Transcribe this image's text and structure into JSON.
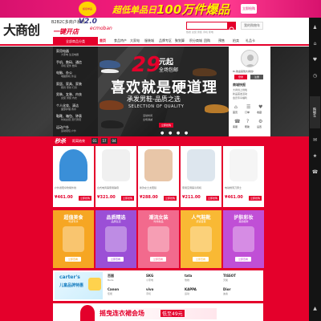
{
  "colors": {
    "brand_red": "#e4002b",
    "banner_pink": "#f21c7a",
    "banner_yellow": "#fff200",
    "hero_dark": "#2b2b2b",
    "sidebar_dark": "#141414"
  },
  "top_banner": {
    "pre": "超低单品日",
    "main": "100万件爆品",
    "badge": "超级单品",
    "button": "立即抢购"
  },
  "logo": {
    "main": "大商创",
    "subtitle": "B2B2C多商户系统",
    "version": "V2.0",
    "slogan": "一键开店",
    "tag": "ecmoban"
  },
  "header": {
    "cart_label": "我的购物车",
    "hot_words": "热搜 女装 男装 手机 家电"
  },
  "nav": {
    "all_categories": "全部商品分类",
    "items": [
      "首页",
      "食品特产",
      "大家电",
      "服装城",
      "品牌专区",
      "聚划算",
      "积分商城",
      "团购",
      "预售",
      "拍卖",
      "礼品卡"
    ]
  },
  "category_menu": [
    {
      "label": "家用电器",
      "sub": "大家电 生活电器"
    },
    {
      "label": "手机、数码、通信",
      "sub": "手机 配件 数码"
    },
    {
      "label": "电脑、办公",
      "sub": "电脑整机 外设"
    },
    {
      "label": "家居、家具、家装",
      "sub": "厨具 家纺 灯具"
    },
    {
      "label": "男装、女装、内衣",
      "sub": "女装 男装 内衣"
    },
    {
      "label": "个人化妆、清洁",
      "sub": "面部护理 香水"
    },
    {
      "label": "鞋靴、箱包、钟表",
      "sub": "时尚女鞋 流行男鞋"
    },
    {
      "label": "运动户外",
      "sub": "运动鞋包 户外"
    }
  ],
  "hero": {
    "number": "29",
    "unit": "元起",
    "shipping": "全场包邮",
    "title": "喜欢就是硬道理",
    "subtitle": "承发男鞋-品质之选",
    "english": "SELECTION OF QUALITY",
    "small1": "活动时间",
    "small2": "全场满减",
    "button": "立即抢购",
    "dots": "● ● ● ●"
  },
  "user_panel": {
    "greeting": "Hi,欢迎来到大商创!",
    "login": "登录",
    "register": "注册",
    "news_title": "商城快报",
    "news": [
      "大商创上线啦",
      "新品首发活动",
      "会员专享福利"
    ],
    "icons": [
      "首页",
      "订单",
      "收藏",
      "客服",
      "帮助",
      "设置"
    ]
  },
  "sidebar_cart": "购物车",
  "flash_sale": {
    "title": "秒杀",
    "label": "距离结束",
    "countdown": [
      "01",
      "57",
      "04"
    ]
  },
  "products": [
    {
      "desc": "户外遮阳伞防紫外线",
      "price": "¥461.00",
      "buy": "立即抢购"
    },
    {
      "desc": "台式电风扇家用静音",
      "price": "¥321.00",
      "buy": "立即抢购"
    },
    {
      "desc": "新款女士太阳镜",
      "price": "¥288.00",
      "buy": "立即抢购"
    },
    {
      "desc": "家用空调扇冷风机",
      "price": "¥211.00",
      "buy": "立即抢购"
    },
    {
      "desc": "电动剃须刀男士",
      "price": "¥461.00",
      "buy": "立即抢购"
    }
  ],
  "category_cards": [
    {
      "title": "超值美食",
      "sub": "吃货专享",
      "button": "立即查看",
      "color": "#f6a623"
    },
    {
      "title": "品质精选",
      "sub": "品质生活",
      "button": "立即查看",
      "color": "#9b4fd6"
    },
    {
      "title": "潮流女装",
      "sub": "时尚新品",
      "button": "立即查看",
      "color": "#f26a8d"
    },
    {
      "title": "人气鞋靴",
      "sub": "舒适百搭",
      "button": "立即查看",
      "color": "#f9b934"
    },
    {
      "title": "护肤彩妆",
      "sub": "美丽相伴",
      "button": "立即查看",
      "color": "#c04fd6"
    }
  ],
  "brand_section": {
    "promo_brand": "carter's",
    "promo_title": "儿童品牌特惠",
    "brands": [
      {
        "logo": "百丽",
        "label": "Belle"
      },
      {
        "logo": "SKG",
        "label": "小家电"
      },
      {
        "logo": "tata",
        "label": "他她"
      },
      {
        "logo": "TISSOT",
        "label": "天梭"
      },
      {
        "logo": "Canon",
        "label": "佳能"
      },
      {
        "logo": "vivo",
        "label": "手机"
      },
      {
        "logo": "KAPPA",
        "label": "运动"
      },
      {
        "logo": "Dior",
        "label": "迪奥"
      }
    ]
  },
  "bottom_banner": {
    "text": "摇曳连衣裙会场",
    "tag": "低至49元"
  }
}
